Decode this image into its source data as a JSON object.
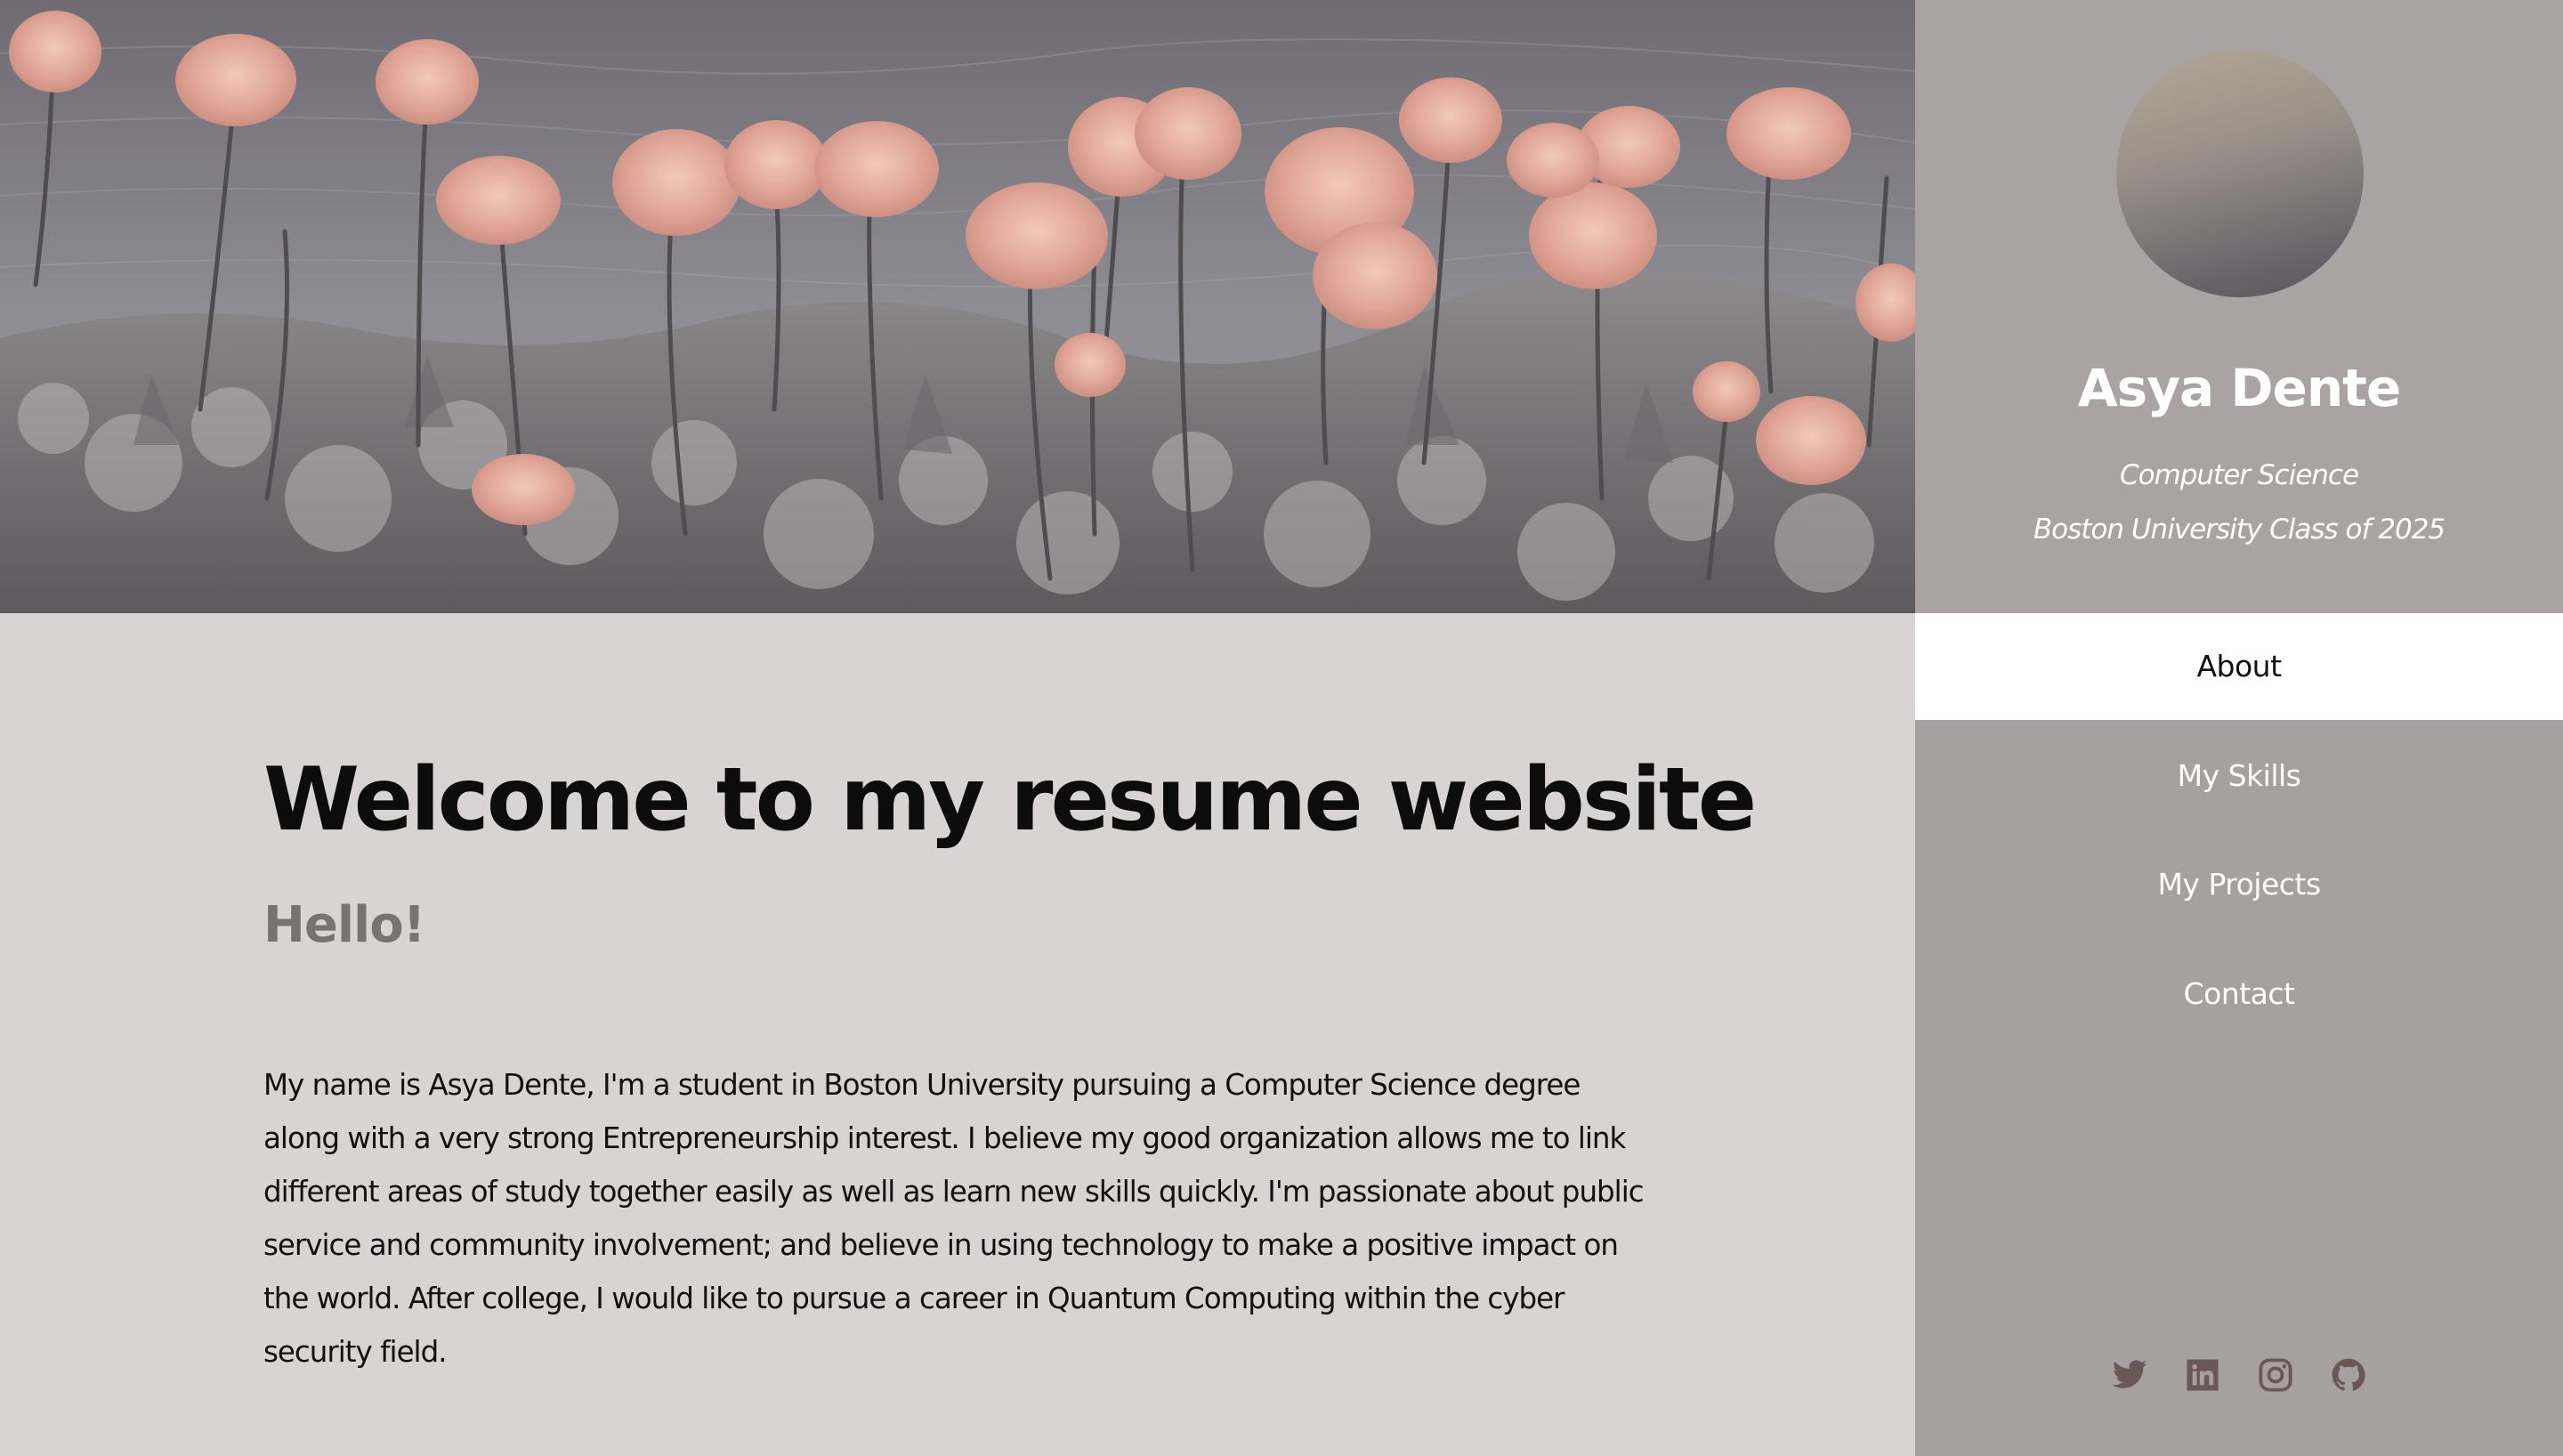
{
  "hero": {
    "image": "tulip-field-by-water"
  },
  "main": {
    "welcome_heading": "Welcome to my resume website",
    "hello_heading": "Hello!",
    "bio": "My name is Asya Dente, I'm a student in Boston University pursuing a Computer Science degree along with a very strong Entrepreneurship interest. I believe my good organization allows me to link different areas of study together easily as well as learn new skills quickly. I'm passionate about public service and community involvement; and believe in using technology to make a positive impact on the world. After college, I would like to pursue a career in Quantum Computing within the cyber security field."
  },
  "sidebar": {
    "name": "Asya Dente",
    "major": "Computer Science",
    "school": "Boston University Class of 2025",
    "nav": [
      {
        "label": "About",
        "active": true
      },
      {
        "label": "My Skills",
        "active": false
      },
      {
        "label": "My Projects",
        "active": false
      },
      {
        "label": "Contact",
        "active": false
      }
    ],
    "socials": [
      "twitter-icon",
      "linkedin-icon",
      "instagram-icon",
      "github-icon"
    ]
  },
  "colors": {
    "sidebar_bg": "#a6a0a0",
    "main_bg": "#d8d4d3",
    "icon_color": "#6b5757",
    "active_nav_bg": "#ffffff"
  }
}
